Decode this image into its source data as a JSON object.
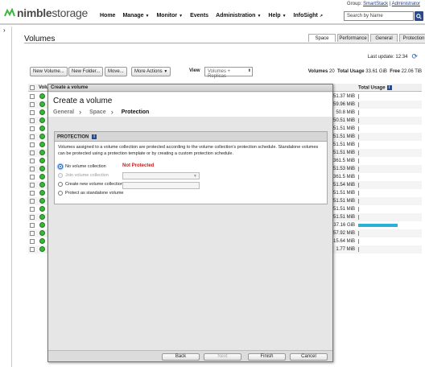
{
  "header": {
    "logo_bold": "nimble",
    "logo_light": "storage",
    "group_prefix": "Group:",
    "group_name": "SmartStack",
    "group_sep": "|",
    "user_name": "Administrator",
    "nav": [
      {
        "label": "Home",
        "caret": ""
      },
      {
        "label": "Manage",
        "caret": "▼"
      },
      {
        "label": "Monitor",
        "caret": "▼"
      },
      {
        "label": "Events",
        "caret": ""
      },
      {
        "label": "Administration",
        "caret": "▼"
      },
      {
        "label": "Help",
        "caret": "▼"
      },
      {
        "label": "InfoSight",
        "caret": "↗"
      }
    ],
    "search_placeholder": "Search by Name"
  },
  "page": {
    "title": "Volumes",
    "tabs": [
      "Space",
      "Performance",
      "General",
      "Protection"
    ],
    "last_update_label": "Last update: 12:34",
    "toolbar": {
      "new_volume": "New Volume...",
      "new_folder": "New Folder...",
      "move": "Move...",
      "more_actions": "More Actions",
      "more_actions_caret": "▼",
      "view_label": "View",
      "view_value": "Volumes + Replicas"
    },
    "totals": {
      "volumes_label": "Volumes",
      "volumes_value": "20",
      "usage_label": "Total Usage",
      "usage_value": "33.61 GiB",
      "free_label": "Free",
      "free_value": "22.06 TiB"
    },
    "table": {
      "col_volume": "Volu",
      "col_total_usage": "Total Usage",
      "rows": [
        {
          "usage": "51.37 MiB",
          "bar": 0
        },
        {
          "usage": "59.96 MiB",
          "bar": 0
        },
        {
          "usage": "50.8 MiB",
          "bar": 0
        },
        {
          "usage": "50.51 MiB",
          "bar": 0
        },
        {
          "usage": "51.51 MiB",
          "bar": 0
        },
        {
          "usage": "51.51 MiB",
          "bar": 0
        },
        {
          "usage": "51.51 MiB",
          "bar": 0
        },
        {
          "usage": "51.51 MiB",
          "bar": 0
        },
        {
          "usage": "361.5 MiB",
          "bar": 0
        },
        {
          "usage": "51.53 MiB",
          "bar": 0
        },
        {
          "usage": "361.5 MiB",
          "bar": 0
        },
        {
          "usage": "51.54 MiB",
          "bar": 0
        },
        {
          "usage": "51.51 MiB",
          "bar": 0
        },
        {
          "usage": "51.51 MiB",
          "bar": 0
        },
        {
          "usage": "51.51 MiB",
          "bar": 0
        },
        {
          "usage": "51.51 MiB",
          "bar": 0
        },
        {
          "usage": "37.16 GiB",
          "bar": 0.76
        },
        {
          "usage": "57.92 MiB",
          "bar": 0
        },
        {
          "usage": "15.64 MiB",
          "bar": 0
        },
        {
          "usage": "1.77 MiB",
          "bar": 0
        }
      ]
    }
  },
  "modal": {
    "titlebar": "Create a volume",
    "heading": "Create a volume",
    "steps": [
      "General",
      "Space",
      "Protection"
    ],
    "step_separator": "〉",
    "panel_title": "PROTECTION",
    "description": "Volumes assigned to a volume collection are protected according to the volume collection's protection schedule. Standalone volumes can be protected using a protection template or by creating a custom protection schedule.",
    "options": [
      {
        "label": "No volume collection",
        "checked": true,
        "disabled": false
      },
      {
        "label": "Join volume collection",
        "checked": false,
        "disabled": true
      },
      {
        "label": "Create new volume collection",
        "checked": false,
        "disabled": false
      },
      {
        "label": "Protect as standalone volume",
        "checked": false,
        "disabled": false
      }
    ],
    "status_text": "Not Protected",
    "buttons": {
      "back": "Back",
      "next": "Next",
      "finish": "Finish",
      "cancel": "Cancel"
    }
  },
  "colors": {
    "status_ok": "#3bb53b",
    "usage_bar": "#2bb0d9",
    "not_protected": "#c02020",
    "brand_blue": "#2a4a8a"
  }
}
